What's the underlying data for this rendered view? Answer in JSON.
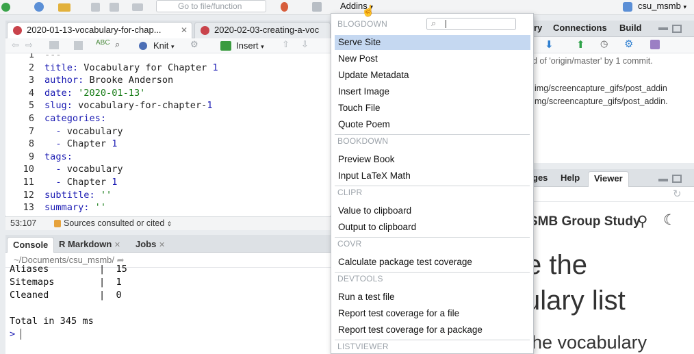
{
  "toolbar": {
    "goto_placeholder": "Go to file/function",
    "addins_label": "Addins",
    "project_label": "csu_msmb"
  },
  "editor": {
    "tabs": [
      {
        "label": "2020-01-13-vocabulary-for-chap..."
      },
      {
        "label": "2020-02-03-creating-a-voc"
      }
    ],
    "knit_label": "Knit",
    "insert_label": "Insert",
    "lines": [
      {
        "n": "1",
        "text": "---"
      },
      {
        "n": "2",
        "key": "title:",
        "val": " Vocabulary for Chapter ",
        "num": "1"
      },
      {
        "n": "3",
        "key": "author:",
        "val": " Brooke Anderson"
      },
      {
        "n": "4",
        "key": "date:",
        "str": " '2020-01-13'"
      },
      {
        "n": "5",
        "key": "slug:",
        "val": " vocabulary-for-chapter-",
        "num": "1"
      },
      {
        "n": "6",
        "key": "categories:"
      },
      {
        "n": "7",
        "dash": "  - ",
        "val": "vocabulary"
      },
      {
        "n": "8",
        "dash": "  - ",
        "val": "Chapter ",
        "num": "1"
      },
      {
        "n": "9",
        "key": "tags:"
      },
      {
        "n": "10",
        "dash": "  - ",
        "val": "vocabulary"
      },
      {
        "n": "11",
        "dash": "  - ",
        "val": "Chapter ",
        "num": "1"
      },
      {
        "n": "12",
        "key": "subtitle:",
        "str": " ''"
      },
      {
        "n": "13",
        "key": "summary:",
        "str": " ''"
      }
    ],
    "status_pos": "53:107",
    "status_section": "Sources consulted or cited"
  },
  "console": {
    "tabs": [
      "Console",
      "R Markdown",
      "Jobs"
    ],
    "path": "~/Documents/csu_msmb/",
    "lines": [
      "Aliases         |  15",
      "Sitemaps        |  1",
      "Cleaned         |  0",
      "",
      "Total in 345 ms"
    ],
    "prompt": ">"
  },
  "right_top": {
    "tabs": [
      "ry",
      "Connections",
      "Build"
    ],
    "git_text": "d of 'origin/master' by 1 commit.",
    "files": [
      "img/screencapture_gifs/post_addin",
      "mg/screencapture_gifs/post_addin."
    ]
  },
  "right_bottom": {
    "tabs": [
      "ges",
      "Help",
      "Viewer"
    ],
    "site_title": "SMB Group Study",
    "heading_line1": "e the",
    "heading_line2": "ulary list",
    "heading_line3": "he vocabulary"
  },
  "menu": {
    "sections": [
      {
        "title": "BLOGDOWN",
        "items": [
          "Serve Site",
          "New Post",
          "Update Metadata",
          "Insert Image",
          "Touch File",
          "Quote Poem"
        ]
      },
      {
        "title": "BOOKDOWN",
        "items": [
          "Preview Book",
          "Input LaTeX Math"
        ]
      },
      {
        "title": "CLIPR",
        "items": [
          "Value to clipboard",
          "Output to clipboard"
        ]
      },
      {
        "title": "COVR",
        "items": [
          "Calculate package test coverage"
        ]
      },
      {
        "title": "DEVTOOLS",
        "items": [
          "Run a test file",
          "Report test coverage for a file",
          "Report test coverage for a package"
        ]
      },
      {
        "title": "LISTVIEWER",
        "items": []
      }
    ],
    "selected": "Serve Site"
  },
  "colors": {
    "accent_blue": "#1b1bb3",
    "string_green": "#137a13",
    "selection": "#c5d8f1"
  }
}
